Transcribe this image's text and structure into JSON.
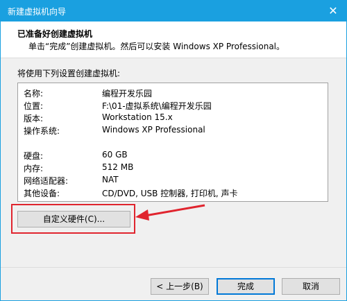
{
  "window": {
    "title": "新建虚拟机向导"
  },
  "header": {
    "title": "已准备好创建虚拟机",
    "subtitle": "单击“完成”创建虚拟机。然后可以安装 Windows XP Professional。"
  },
  "section_label": "将使用下列设置创建虚拟机:",
  "summary": [
    {
      "key": "名称:",
      "value": "编程开发乐园"
    },
    {
      "key": "位置:",
      "value": "F:\\01-虚拟系统\\编程开发乐园"
    },
    {
      "key": "版本:",
      "value": "Workstation 15.x"
    },
    {
      "key": "操作系统:",
      "value": "Windows XP Professional"
    },
    {
      "key": "硬盘:",
      "value": "60 GB"
    },
    {
      "key": "内存:",
      "value": "512 MB"
    },
    {
      "key": "网络适配器:",
      "value": "NAT"
    },
    {
      "key": "其他设备:",
      "value": "CD/DVD, USB 控制器, 打印机, 声卡"
    }
  ],
  "buttons": {
    "customize": "自定义硬件(C)...",
    "back": "< 上一步(B)",
    "finish": "完成",
    "cancel": "取消"
  },
  "colors": {
    "accent": "#1aa0e0",
    "highlight": "#e0242e"
  }
}
